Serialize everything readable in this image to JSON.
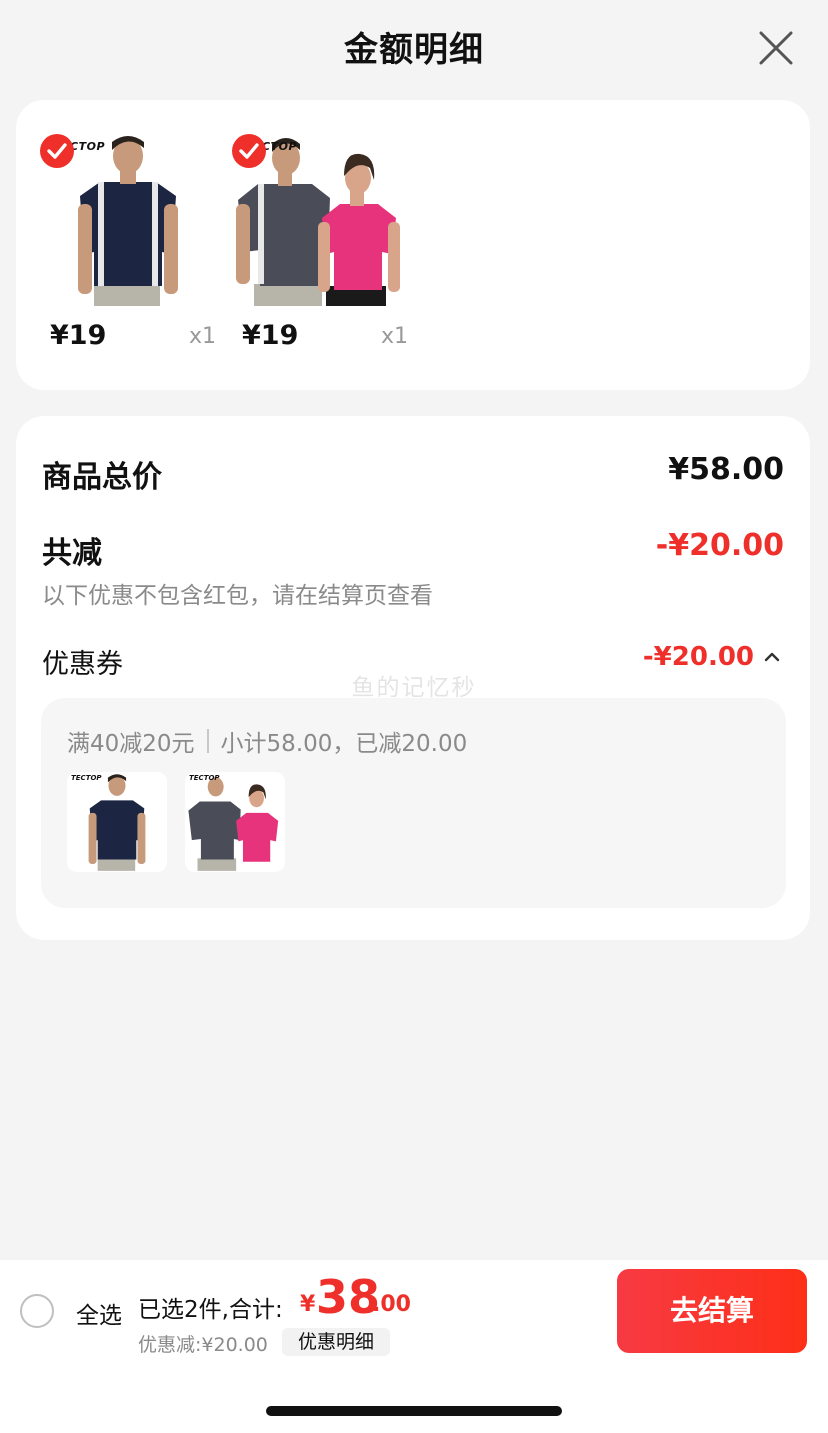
{
  "header": {
    "title": "金额明细"
  },
  "products": [
    {
      "brand": "TECTOP",
      "price": "¥19",
      "qty": "x1"
    },
    {
      "brand": "TECTOP",
      "price": "¥19",
      "qty": "x1"
    }
  ],
  "summary": {
    "total_label": "商品总价",
    "total_value": "¥58.00",
    "discount_label": "共减",
    "discount_value": "-¥20.00",
    "note": "以下优惠不包含红包，请在结算页查看",
    "coupon_label": "优惠券",
    "coupon_value": "-¥20.00",
    "coupon_rule": "满40减20元",
    "coupon_subtotal": "小计58.00，已减20.00",
    "coupon_items": [
      {
        "brand": "TECTOP"
      },
      {
        "brand": "TECTOP"
      }
    ]
  },
  "watermark": "鱼的记忆秒",
  "bottom": {
    "select_all": "全选",
    "selected_text": "已选2件,合计:",
    "currency": "¥",
    "total_int": "38",
    "total_dec": ".00",
    "discount_text": "优惠减:¥20.00",
    "detail_button": "优惠明细",
    "checkout_button": "去结算"
  },
  "colors": {
    "accent": "#ee2f2a",
    "checkout_gradient_start": "#f73a43",
    "checkout_gradient_end": "#fd2f17"
  },
  "icons": {
    "close": "close-icon",
    "check": "check-circle-icon",
    "chevron": "chevron-up-icon"
  }
}
